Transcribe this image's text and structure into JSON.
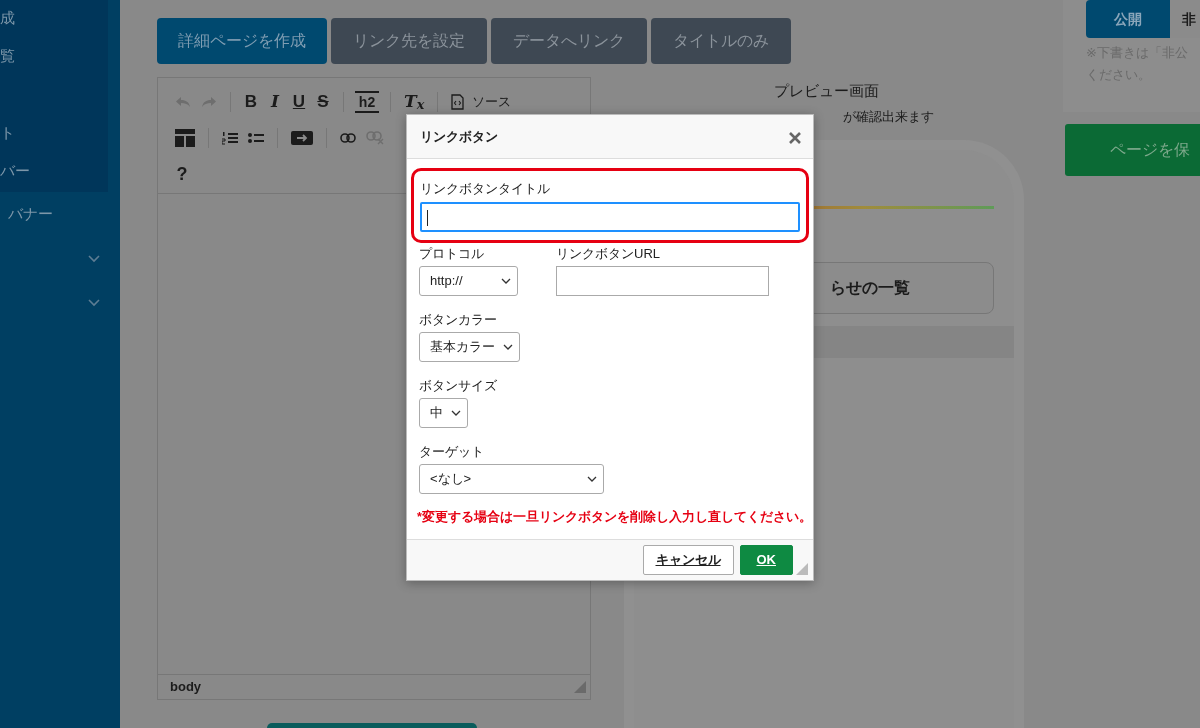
{
  "sidebar": {
    "submenu": [
      "成",
      "覧",
      "ト",
      "バー"
    ],
    "items": [
      {
        "label": "バナー",
        "kind": "link"
      },
      {
        "kind": "dropdown",
        "expanded": false
      },
      {
        "kind": "dropdown",
        "expanded": false
      }
    ]
  },
  "mode_buttons": [
    {
      "label": "詳細ページを作成",
      "selected": true
    },
    {
      "label": "リンク先を設定",
      "selected": false
    },
    {
      "label": "データへリンク",
      "selected": false
    },
    {
      "label": "タイトルのみ",
      "selected": false
    }
  ],
  "editor": {
    "toolbar": [
      [
        [
          {
            "kind": "undo",
            "disabled": true
          },
          {
            "kind": "redo",
            "disabled": true
          }
        ],
        [
          {
            "kind": "bold",
            "label": "B"
          },
          {
            "kind": "italic",
            "label": "I"
          },
          {
            "kind": "underline",
            "label": "U"
          },
          {
            "kind": "strike",
            "label": "S"
          }
        ],
        [
          {
            "kind": "heading",
            "label": "h2"
          }
        ],
        [
          {
            "kind": "clear-format",
            "label": "T$_{x}$"
          }
        ],
        [
          {
            "kind": "source",
            "label": "ソース"
          }
        ]
      ],
      [
        [
          {
            "kind": "template"
          }
        ],
        [
          {
            "kind": "ordered-list"
          },
          {
            "kind": "bullet-list"
          }
        ],
        [
          {
            "kind": "link-button"
          }
        ],
        [
          {
            "kind": "link"
          },
          {
            "kind": "unlink",
            "disabled": true
          }
        ]
      ],
      [
        [
          {
            "kind": "help",
            "label": "?"
          }
        ]
      ]
    ],
    "status": "body"
  },
  "preview": {
    "title": "プレビュー画面",
    "subtitle": "が確認出来ます",
    "button": "らせの一覧"
  },
  "publish": {
    "tabs": [
      {
        "label": "公開",
        "selected": true
      },
      {
        "label": "非",
        "selected": false
      }
    ],
    "note_lines": [
      "※下書きは「非公",
      "ください。"
    ],
    "save_button": "ページを保"
  },
  "dialog": {
    "title": "リンクボタン",
    "rows": [
      [
        {
          "label": "リンクボタンタイトル",
          "kind": "text",
          "focused": true,
          "highlighted": true
        }
      ],
      [
        {
          "label": "プロトコル",
          "kind": "select",
          "value": "http://"
        },
        {
          "label": "リンクボタンURL",
          "kind": "text",
          "focused": false,
          "highlighted": false
        }
      ],
      [
        {
          "label": "ボタンカラー",
          "kind": "select",
          "value": "基本カラー"
        }
      ],
      [
        {
          "label": "ボタンサイズ",
          "kind": "select",
          "value": "中"
        }
      ],
      [
        {
          "label": "ターゲット",
          "kind": "select",
          "value": "<なし>"
        }
      ]
    ],
    "note": "*変更する場合は一旦リンクボタンを削除し入力し直してください。",
    "buttons": [
      {
        "label": "キャンセル",
        "kind": "secondary"
      },
      {
        "label": "OK",
        "kind": "primary"
      }
    ]
  }
}
